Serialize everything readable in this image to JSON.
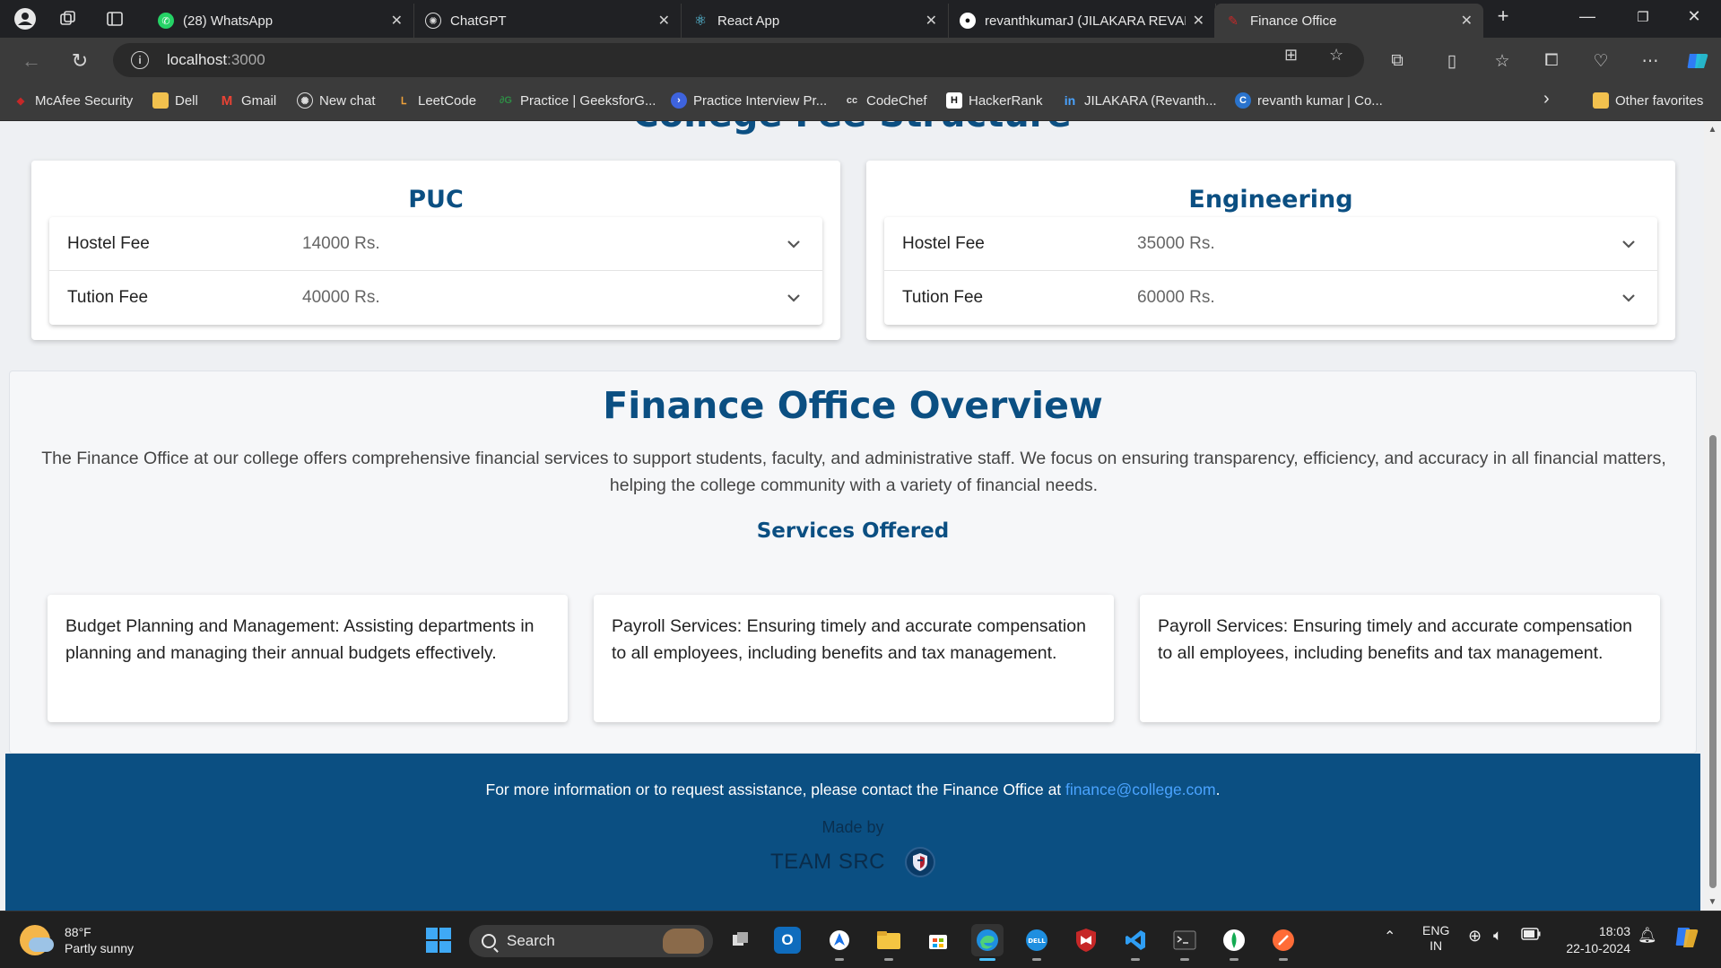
{
  "browser": {
    "tabs": [
      {
        "title": "(28) WhatsApp",
        "icon": "whatsapp-icon",
        "active": false
      },
      {
        "title": "ChatGPT",
        "icon": "chatgpt-icon",
        "active": false
      },
      {
        "title": "React App",
        "icon": "react-icon",
        "active": false
      },
      {
        "title": "revanthkumarJ (JILAKARA REVAN",
        "icon": "github-icon",
        "active": false
      },
      {
        "title": "Finance Office",
        "icon": "page-icon",
        "active": true
      }
    ],
    "url_host": "localhost",
    "url_port": ":3000",
    "favorites": [
      {
        "label": "McAfee Security",
        "icon": "mcafee-icon"
      },
      {
        "label": "Dell",
        "icon": "folder-icon"
      },
      {
        "label": "Gmail",
        "icon": "gmail-icon"
      },
      {
        "label": "New chat",
        "icon": "chatgpt-icon"
      },
      {
        "label": "LeetCode",
        "icon": "leetcode-icon"
      },
      {
        "label": "Practice | GeeksforG...",
        "icon": "gfg-icon"
      },
      {
        "label": "Practice Interview Pr...",
        "icon": "interview-icon"
      },
      {
        "label": "CodeChef",
        "icon": "codechef-icon"
      },
      {
        "label": "HackerRank",
        "icon": "hackerrank-icon"
      },
      {
        "label": "JILAKARA (Revanth...",
        "icon": "linkedin-icon"
      },
      {
        "label": "revanth kumar | Co...",
        "icon": "coursera-icon"
      }
    ],
    "other_favorites": "Other favorites"
  },
  "page": {
    "cut_title": "College Fee Structure",
    "fee_cards": [
      {
        "title": "PUC",
        "rows": [
          {
            "label": "Hostel Fee",
            "amount": "14000 Rs."
          },
          {
            "label": "Tution Fee",
            "amount": "40000 Rs."
          }
        ]
      },
      {
        "title": "Engineering",
        "rows": [
          {
            "label": "Hostel Fee",
            "amount": "35000 Rs."
          },
          {
            "label": "Tution Fee",
            "amount": "60000 Rs."
          }
        ]
      }
    ],
    "overview": {
      "title": "Finance Office Overview",
      "description": "The Finance Office at our college offers comprehensive financial services to support students, faculty, and administrative staff. We focus on ensuring transparency, efficiency, and accuracy in all financial matters, helping the college community with a variety of financial needs.",
      "services_title": "Services Offered",
      "services": [
        "Budget Planning and Management: Assisting departments in planning and managing their annual budgets effectively.",
        "Payroll Services: Ensuring timely and accurate compensation to all employees, including benefits and tax management.",
        "Payroll Services: Ensuring timely and accurate compensation to all employees, including benefits and tax management."
      ]
    },
    "footer": {
      "contact_text": "For more information or to request assistance, please contact the Finance Office at ",
      "email": "finance@college.com",
      "period": ".",
      "made_by": "Made by",
      "team": "TEAM SRC"
    }
  },
  "taskbar": {
    "weather_temp": "88°F",
    "weather_desc": "Partly sunny",
    "search_label": "Search",
    "lang_top": "ENG",
    "lang_bottom": "IN",
    "time": "18:03",
    "date": "22-10-2024"
  },
  "colors": {
    "accent": "#0b4f82",
    "link": "#4aa3ff"
  }
}
